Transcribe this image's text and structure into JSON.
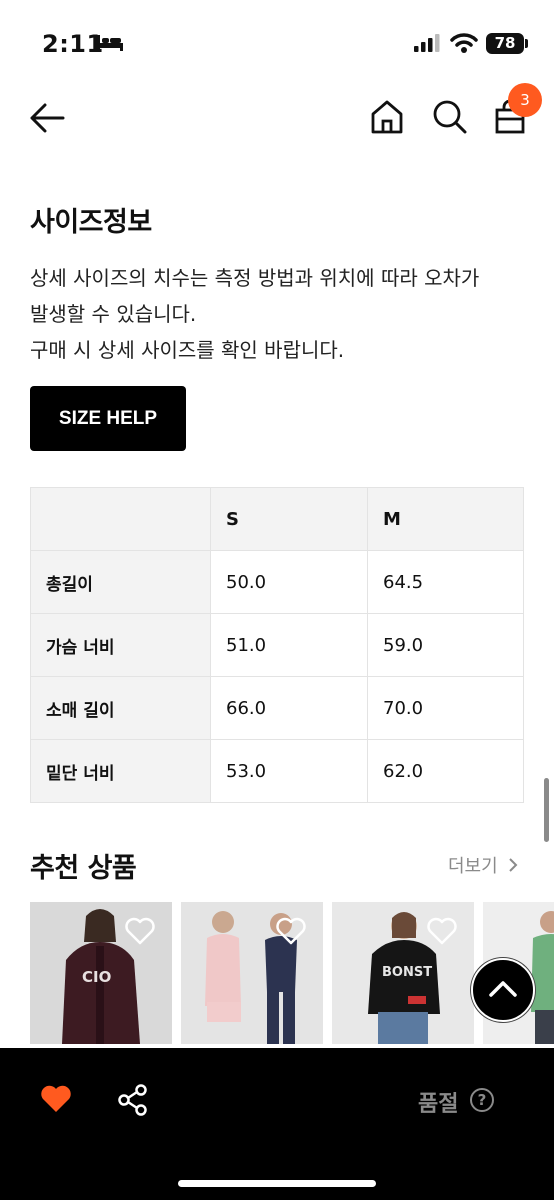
{
  "status_bar": {
    "time": "2:11",
    "battery": "78"
  },
  "header": {
    "cart_badge": "3",
    "accent_color": "#ff5a1f"
  },
  "size_info": {
    "title": "사이즈정보",
    "description": [
      "상세 사이즈의 치수는 측정 방법과 위치에 따라 오차가",
      "발생할 수 있습니다.",
      "구매 시 상세 사이즈를 확인 바랍니다."
    ],
    "help_button": "SIZE HELP",
    "table": {
      "columns": [
        "",
        "S",
        "M"
      ],
      "rows": [
        {
          "label": "총길이",
          "values": [
            "50.0",
            "64.5"
          ]
        },
        {
          "label": "가슴 너비",
          "values": [
            "51.0",
            "59.0"
          ]
        },
        {
          "label": "소매 길이",
          "values": [
            "66.0",
            "70.0"
          ]
        },
        {
          "label": "밑단 너비",
          "values": [
            "53.0",
            "62.0"
          ]
        }
      ]
    }
  },
  "recommended": {
    "title": "추천 상품",
    "more_label": "더보기",
    "products": [
      {
        "image": "model in dark burgundy zip hoodie",
        "print": "CIO",
        "bg": "#dcdcdc"
      },
      {
        "image": "models in pink and navy tracksuits",
        "bg": "#e2e2e2"
      },
      {
        "image": "model in black hoodie with blue jeans",
        "print": "BONST",
        "bg": "#e8e8e8"
      },
      {
        "image": "model in green top",
        "bg": "#eeeeee"
      }
    ]
  },
  "bottom_bar": {
    "status_label": "품절",
    "help_icon": "?"
  }
}
